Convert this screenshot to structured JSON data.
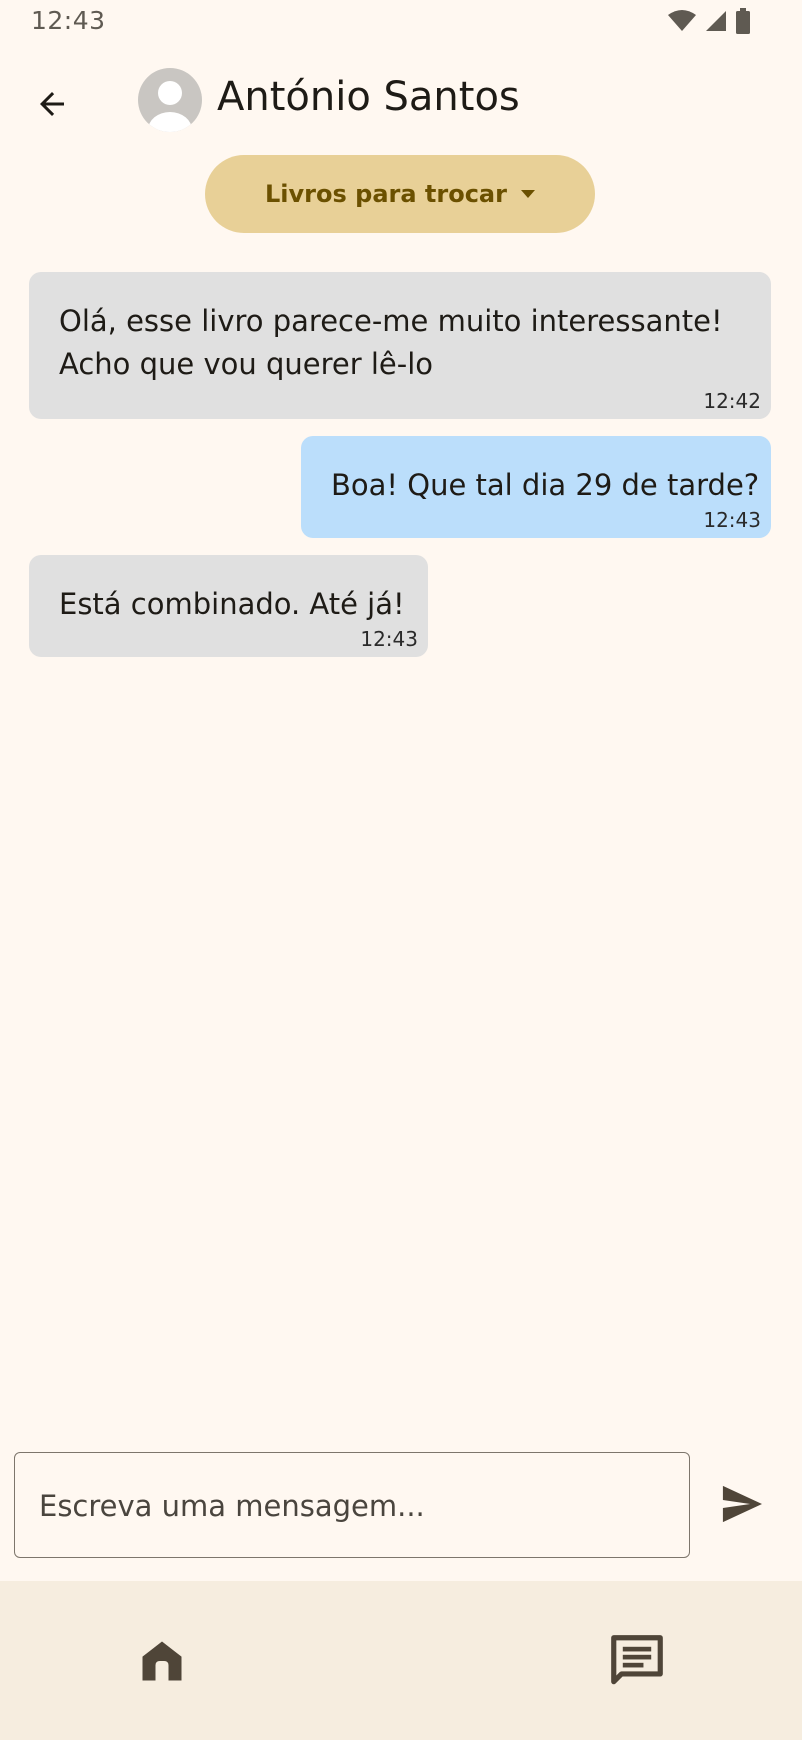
{
  "status_bar": {
    "time": "12:43",
    "icons": [
      "wifi-icon",
      "cell-signal-icon",
      "battery-icon"
    ]
  },
  "header": {
    "back_icon": "arrow-back-icon",
    "avatar_icon": "person-avatar-icon",
    "contact_name": "António Santos"
  },
  "category_selector": {
    "selected": "Livros para trocar",
    "icon": "dropdown-arrow-icon"
  },
  "messages": [
    {
      "direction": "received",
      "lines": [
        "Olá, esse livro parece-me muito interessante!",
        "Acho que vou querer lê-lo"
      ],
      "time": "12:42"
    },
    {
      "direction": "sent",
      "lines": [
        "Boa! Que tal dia 29 de tarde?"
      ],
      "time": "12:43"
    },
    {
      "direction": "received",
      "lines": [
        "Está combinado. Até já!"
      ],
      "time": "12:43"
    }
  ],
  "composer": {
    "placeholder": "Escreva uma mensagem...",
    "value": "",
    "send_icon": "send-icon"
  },
  "bottom_nav": {
    "items": [
      {
        "icon": "home-icon"
      },
      {
        "icon": "chat-icon"
      }
    ]
  },
  "colors": {
    "background": "#FFF8F1",
    "received_bubble": "#E0E0E0",
    "sent_bubble": "#BBDEFB",
    "dropdown": "#E8D097",
    "nav_background": "#F6EDDF",
    "icon_dark": "#4F4538"
  }
}
